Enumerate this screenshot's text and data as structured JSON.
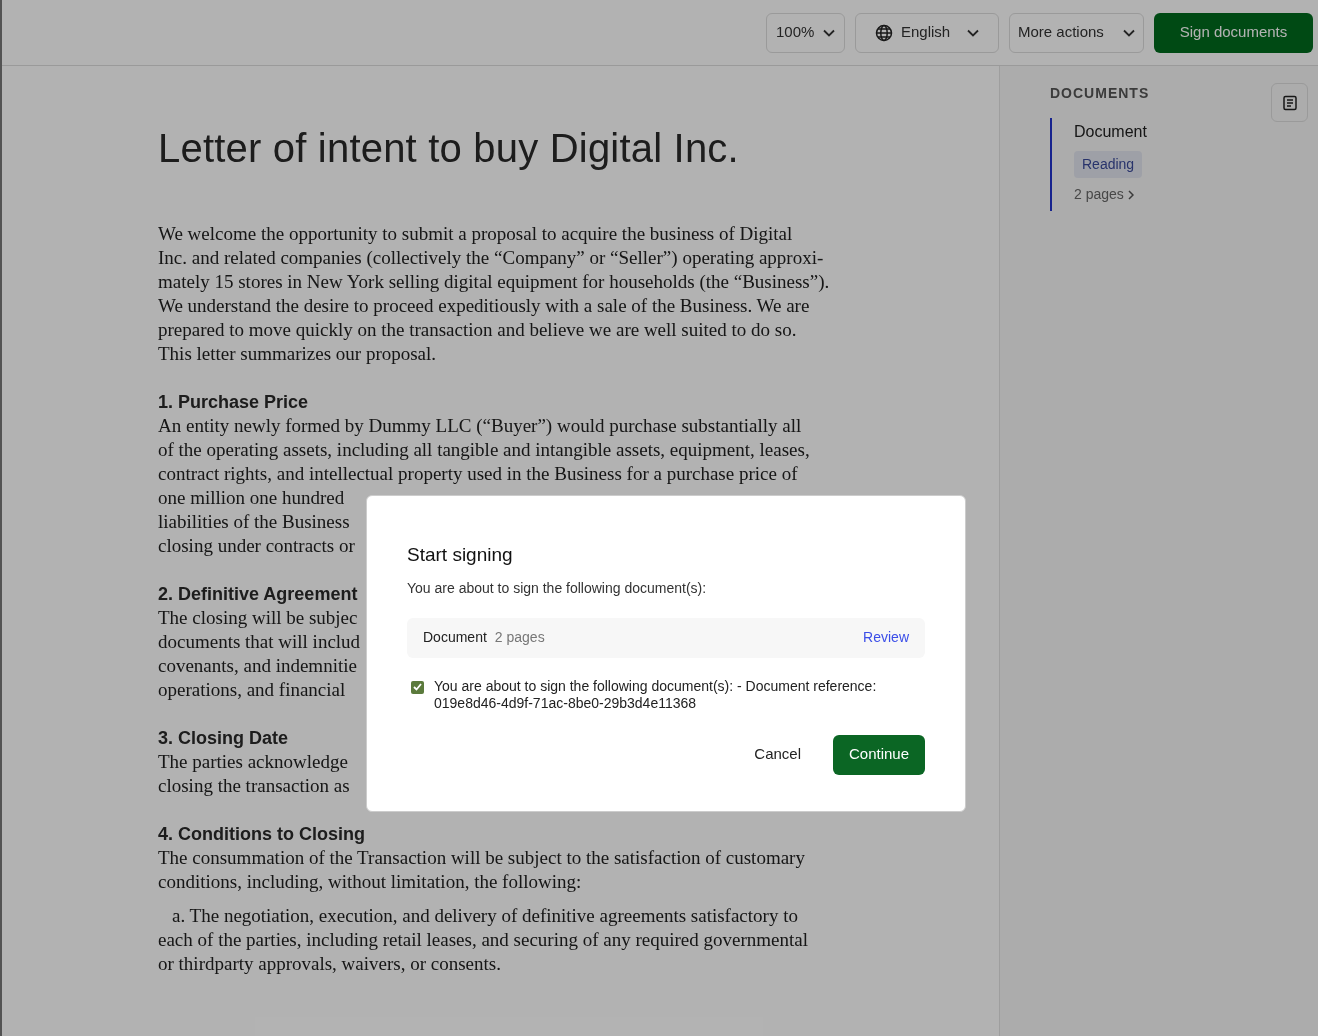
{
  "toolbar": {
    "zoom": "100%",
    "language": "English",
    "more_actions": "More actions",
    "sign_button": "Sign documents"
  },
  "document": {
    "title": "Letter of intent to buy Digital Inc.",
    "blocks": [
      {
        "kind": "paragraph",
        "lines": [
          "We welcome the opportunity to submit a proposal to acquire the business of Digital",
          "Inc. and related companies (collectively the “Company” or “Seller”) operating approxi-",
          "mately 15 stores in New York selling digital equipment for households (the “Business”).",
          "We understand the desire to proceed expeditiously with a sale of the Business. We are",
          "prepared to move quickly on the transaction and believe we are well suited to do so.",
          "This letter summarizes our proposal."
        ]
      },
      {
        "kind": "section",
        "heading": "1. Purchase Price",
        "lines": [
          "An entity newly formed by Dummy LLC (“Buyer”) would purchase substantially all",
          "of the operating assets, including all tangible and intangible assets, equipment, leases,",
          "contract rights, and intellectual property used in the Business for a purchase price of",
          "one million one hundred",
          "liabilities of the Business",
          "closing under contracts or"
        ]
      },
      {
        "kind": "section",
        "heading": "2. Definitive Agreement",
        "lines": [
          "The closing will be subjec",
          "documents that will includ",
          "covenants, and indemnitie",
          "operations, and financial"
        ]
      },
      {
        "kind": "section",
        "heading": "3. Closing Date",
        "lines": [
          "The parties acknowledge",
          "closing the transaction as"
        ]
      },
      {
        "kind": "section",
        "heading": "4. Conditions to Closing",
        "lines": [
          "The consummation of the Transaction will be subject to the satisfaction of customary",
          "conditions, including, without limitation, the following:"
        ]
      },
      {
        "kind": "list_item",
        "lines": [
          "a. The negotiation, execution, and delivery of definitive agreements satisfactory to",
          "each of the parties, including retail leases, and securing of any required governmental",
          "or thirdparty approvals, waivers, or consents."
        ]
      }
    ]
  },
  "sidebar": {
    "heading": "DOCUMENTS",
    "items": [
      {
        "name": "Document",
        "status": "Reading",
        "pages": "2 pages",
        "selected": true
      }
    ]
  },
  "dialog": {
    "title": "Start signing",
    "intro": "You are about to sign the following document(s):",
    "document": {
      "name": "Document",
      "pages": "2 pages",
      "review": "Review"
    },
    "consent": {
      "checked": true,
      "text": "You are about to sign the following document(s): - Document reference: 019e8d46-4d9f-71ac-8be0-29b3d4e11368"
    },
    "cancel": "Cancel",
    "continue": "Continue"
  }
}
